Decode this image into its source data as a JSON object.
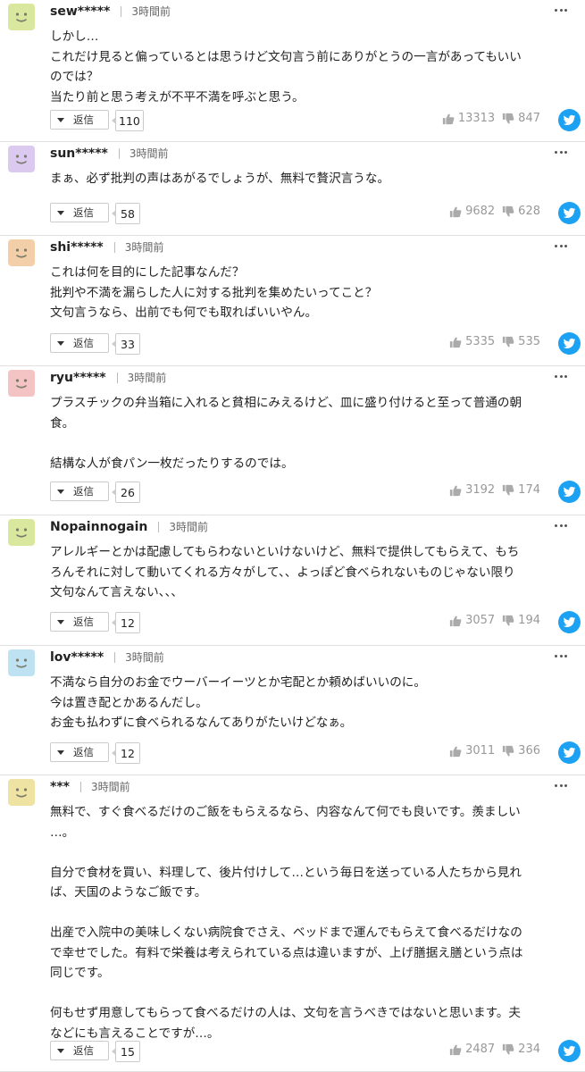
{
  "reply_label": "返信",
  "comments": [
    {
      "user": "sew*****",
      "time": "3時間前",
      "avatar_color": "#d9e79f",
      "lines": [
        "しかし…",
        "これだけ見ると偏っているとは思うけど文句言う前にありがとうの一言があってもいい",
        "のでは？",
        "当たり前と思う考えが不平不満を呼ぶと思う。"
      ],
      "replies": "110",
      "likes": "13313",
      "dislikes": "847"
    },
    {
      "user": "sun*****",
      "time": "3時間前",
      "avatar_color": "#dbc9f0",
      "lines": [
        "まぁ、必ず批判の声はあがるでしょうが、無料で贅沢言うな。"
      ],
      "replies": "58",
      "likes": "9682",
      "dislikes": "628"
    },
    {
      "user": "shi*****",
      "time": "3時間前",
      "avatar_color": "#f3cfa9",
      "lines": [
        "これは何を目的にした記事なんだ？",
        "批判や不満を漏らした人に対する批判を集めたいってこと？",
        "文句言うなら、出前でも何でも取ればいいやん。"
      ],
      "replies": "33",
      "likes": "5335",
      "dislikes": "535"
    },
    {
      "user": "ryu*****",
      "time": "3時間前",
      "avatar_color": "#f4c3c3",
      "lines": [
        "プラスチックの弁当箱に入れると貧相にみえるけど、皿に盛り付けると至って普通の朝",
        "食。",
        "",
        "結構な人が食パン一枚だったりするのでは。"
      ],
      "replies": "26",
      "likes": "3192",
      "dislikes": "174"
    },
    {
      "user": "Nopainnogain",
      "time": "3時間前",
      "avatar_color": "#d9e79f",
      "lines": [
        "アレルギーとかは配慮してもらわないといけないけど、無料で提供してもらえて、もち",
        "ろんそれに対して動いてくれる方々がして、、よっぽど食べられないものじゃない限り",
        "文句なんて言えない、、、"
      ],
      "replies": "12",
      "likes": "3057",
      "dislikes": "194"
    },
    {
      "user": "lov*****",
      "time": "3時間前",
      "avatar_color": "#bfe2f2",
      "lines": [
        "不満なら自分のお金でウーバーイーツとか宅配とか頼めばいいのに。",
        "今は置き配とかあるんだし。",
        "お金も払わずに食べられるなんてありがたいけどなぁ。"
      ],
      "replies": "12",
      "likes": "3011",
      "dislikes": "366"
    },
    {
      "user": "***",
      "time": "3時間前",
      "avatar_color": "#efe3a3",
      "lines": [
        "無料で、すぐ食べるだけのご飯をもらえるなら、内容なんて何でも良いです。羨ましい",
        "…。",
        "",
        "自分で食材を買い、料理して、後片付けして…という毎日を送っている人たちから見れ",
        "ば、天国のようなご飯です。",
        "",
        "出産で入院中の美味しくない病院食でさえ、ベッドまで運んでもらえて食べるだけなの",
        "で幸せでした。有料で栄養は考えられている点は違いますが、上げ膳据え膳という点は",
        "同じです。",
        "",
        "何もせず用意してもらって食べるだけの人は、文句を言うべきではないと思います。夫",
        "などにも言えることですが…。"
      ],
      "replies": "15",
      "likes": "2487",
      "dislikes": "234"
    }
  ]
}
